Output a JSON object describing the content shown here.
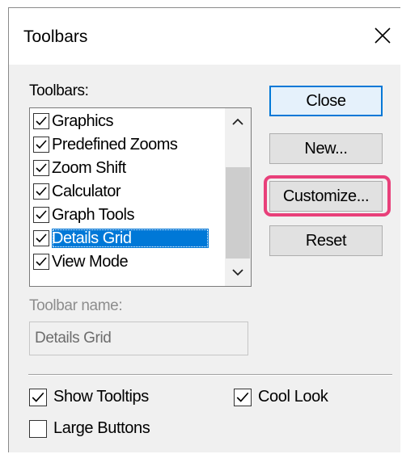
{
  "window": {
    "title": "Toolbars",
    "close_icon": "close-icon"
  },
  "toolbars_label": "Toolbars:",
  "toolbar_list": {
    "items": [
      {
        "label": "Graphics",
        "checked": true,
        "selected": false
      },
      {
        "label": "Predefined Zooms",
        "checked": true,
        "selected": false
      },
      {
        "label": "Zoom Shift",
        "checked": true,
        "selected": false
      },
      {
        "label": "Calculator",
        "checked": true,
        "selected": false
      },
      {
        "label": "Graph Tools",
        "checked": true,
        "selected": false
      },
      {
        "label": "Details Grid",
        "checked": true,
        "selected": true
      },
      {
        "label": "View Mode",
        "checked": true,
        "selected": false
      }
    ],
    "scroll_up_icon": "chevron-up-icon",
    "scroll_down_icon": "chevron-down-icon"
  },
  "buttons": {
    "close": "Close",
    "new": "New...",
    "customize": "Customize...",
    "reset": "Reset"
  },
  "toolbar_name": {
    "label": "Toolbar name:",
    "value": "Details Grid"
  },
  "options": {
    "show_tooltips": {
      "label": "Show Tooltips",
      "checked": true
    },
    "cool_look": {
      "label": "Cool Look",
      "checked": true
    },
    "large_buttons": {
      "label": "Large Buttons",
      "checked": false
    }
  },
  "colors": {
    "selection": "#0078d7",
    "highlight_ring": "#e8407a",
    "dialog_bg": "#f0f0f0"
  }
}
